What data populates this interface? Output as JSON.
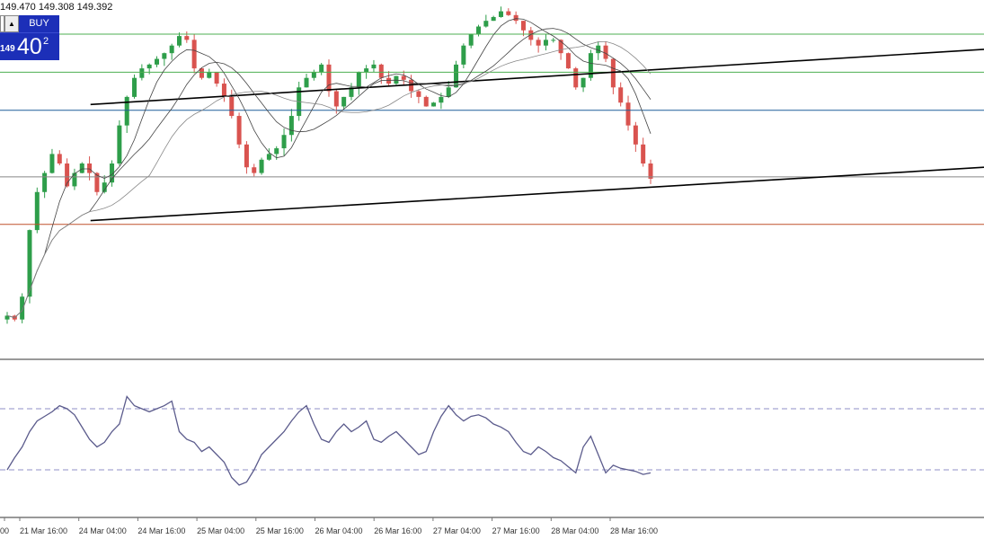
{
  "header": {
    "ohlc_text": "149.470 149.308 149.392"
  },
  "trade_panel": {
    "buy_label": "BUY",
    "buy_price_small": "149",
    "buy_price_big": "40",
    "buy_price_sup": "2",
    "arrow_glyph": "▲"
  },
  "colors": {
    "bull": "#2e9e4a",
    "bear": "#d9534f",
    "resistance": "#4caf50",
    "mid_level": "#1f5f99",
    "support_red": "#c0502b",
    "gray_level": "#888888",
    "trendline": "#000000",
    "ma_fast": "#444444",
    "ma_slow": "#888888",
    "oscillator": "#5b5b8c",
    "osc_level": "#8f8fc7"
  },
  "chart_data": [
    {
      "type": "candlestick",
      "title": "",
      "x_ticks": [
        "00",
        "21 Mar 16:00",
        "24 Mar 04:00",
        "24 Mar 16:00",
        "25 Mar 04:00",
        "25 Mar 16:00",
        "26 Mar 04:00",
        "26 Mar 16:00",
        "27 Mar 04:00",
        "27 Mar 16:00",
        "28 Mar 04:00",
        "28 Mar 16:00"
      ],
      "y_range": [
        148.58,
        150.45
      ],
      "price_series": [
        148.8,
        148.78,
        148.9,
        149.25,
        149.45,
        149.55,
        149.65,
        149.6,
        149.48,
        149.55,
        149.6,
        149.55,
        149.45,
        149.5,
        149.6,
        149.8,
        149.95,
        150.05,
        150.1,
        150.12,
        150.15,
        150.18,
        150.22,
        150.27,
        150.25,
        150.1,
        150.05,
        150.08,
        150.02,
        149.95,
        149.85,
        149.7,
        149.58,
        149.55,
        149.62,
        149.65,
        149.68,
        149.75,
        149.85,
        150.0,
        150.05,
        150.08,
        150.12,
        149.98,
        149.9,
        149.95,
        150.0,
        150.08,
        150.1,
        150.12,
        150.05,
        150.02,
        150.06,
        150.04,
        149.98,
        149.95,
        149.9,
        149.92,
        149.95,
        150.0,
        150.12,
        150.22,
        150.28,
        150.32,
        150.35,
        150.37,
        150.4,
        150.38,
        150.35,
        150.3,
        150.25,
        150.22,
        150.25,
        150.25,
        150.18,
        150.1,
        150.0,
        150.05,
        150.18,
        150.22,
        150.15,
        150.0,
        149.92,
        149.8,
        149.7,
        149.6,
        149.52
      ],
      "horizontal_levels": [
        {
          "price": 150.28,
          "color_key": "resistance"
        },
        {
          "price": 150.08,
          "color_key": "resistance"
        },
        {
          "price": 149.88,
          "color_key": "mid_level"
        },
        {
          "price": 149.53,
          "color_key": "gray_level"
        },
        {
          "price": 149.28,
          "color_key": "support_red"
        }
      ],
      "trendlines": [
        {
          "x_start": 0.092,
          "y_start": 149.91,
          "x_end": 1.0,
          "y_end": 150.2
        },
        {
          "x_start": 0.092,
          "y_start": 149.3,
          "x_end": 1.0,
          "y_end": 149.58
        }
      ]
    },
    {
      "type": "line",
      "title": "",
      "y_range": [
        0,
        100
      ],
      "levels": [
        70,
        30
      ],
      "values": [
        30,
        38,
        45,
        55,
        62,
        65,
        68,
        72,
        70,
        66,
        58,
        50,
        45,
        48,
        55,
        60,
        78,
        72,
        70,
        68,
        70,
        72,
        75,
        55,
        50,
        48,
        42,
        45,
        40,
        35,
        25,
        20,
        22,
        30,
        40,
        45,
        50,
        55,
        62,
        68,
        72,
        60,
        50,
        48,
        55,
        60,
        55,
        58,
        62,
        50,
        48,
        52,
        55,
        50,
        45,
        40,
        42,
        55,
        65,
        72,
        66,
        62,
        65,
        66,
        64,
        60,
        58,
        55,
        48,
        42,
        40,
        45,
        42,
        38,
        36,
        32,
        28,
        45,
        52,
        40,
        28,
        33,
        31,
        30,
        29,
        27,
        28
      ]
    }
  ]
}
